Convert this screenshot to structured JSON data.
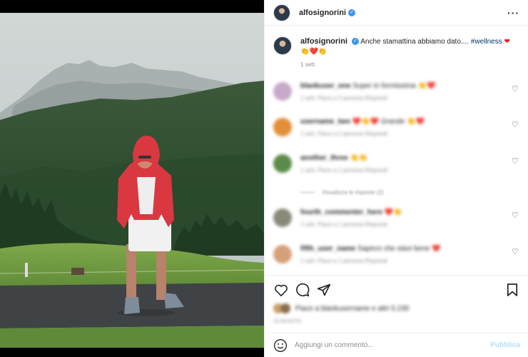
{
  "post": {
    "username": "alfosignorini",
    "caption_text": "Anche stamattina abbiamo dato.... ",
    "hashtag": "#wellness",
    "caption_emojis": "👏❤️👏",
    "time": "1 sett."
  },
  "comments": [
    {
      "user": "blankuser_one",
      "text": "Super in formissima 👏❤️",
      "meta": "1 sett.  Piace a 3 persone  Rispondi",
      "avatar_color": "#c8a9c9"
    },
    {
      "user": "username_two",
      "text": "❤️👏❤️ Grande 👏❤️",
      "meta": "1 sett.  Piace a 2 persone  Rispondi",
      "avatar_color": "#e38f3a"
    },
    {
      "user": "another_three",
      "text": "👏👏",
      "meta": "1 sett.  Piace a 1 persona  Rispondi",
      "avatar_color": "#5c8a4a"
    },
    {
      "user": "fourth_commenter_here",
      "text": "❤️👏",
      "meta": "1 sett.  Piace a 1 persona  Rispondi",
      "avatar_color": "#8a8a7a"
    },
    {
      "user": "fifth_user_name",
      "text": "Sapevo che stavi bene ❤️",
      "meta": "1 sett.  Piace a 1 persona  Rispondi",
      "avatar_color": "#d6a07a"
    }
  ],
  "view_replies": "Visualizza le risposte (2)",
  "likes": {
    "text": "Piace a blankusername e altri 5.230",
    "date": "28 AGOSTO"
  },
  "add_comment": {
    "placeholder": "Aggiungi un commento...",
    "publish": "Pubblica"
  },
  "colors": {
    "heart": "#ed1c24",
    "link": "#00376b",
    "publish": "#b2dffc",
    "verified": "#3897f0"
  }
}
